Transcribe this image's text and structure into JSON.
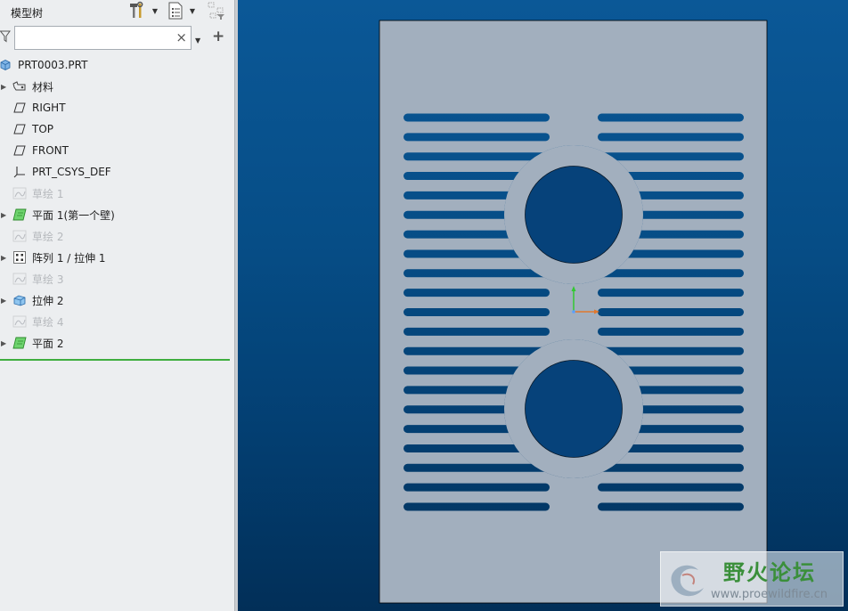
{
  "panel": {
    "title": "模型树",
    "search": {
      "value": "",
      "placeholder": "",
      "clear_symbol": "×",
      "add_symbol": "+"
    }
  },
  "tree": {
    "items": [
      {
        "label": "PRT0003.PRT",
        "icon": "part-icon",
        "expandable": false,
        "suppressed": false
      },
      {
        "label": "材料",
        "icon": "material-icon",
        "expandable": true,
        "suppressed": false
      },
      {
        "label": "RIGHT",
        "icon": "datum-plane-icon",
        "expandable": false,
        "suppressed": false
      },
      {
        "label": "TOP",
        "icon": "datum-plane-icon",
        "expandable": false,
        "suppressed": false
      },
      {
        "label": "FRONT",
        "icon": "datum-plane-icon",
        "expandable": false,
        "suppressed": false
      },
      {
        "label": "PRT_CSYS_DEF",
        "icon": "csys-icon",
        "expandable": false,
        "suppressed": false
      },
      {
        "label": "草绘 1",
        "icon": "sketch-icon",
        "expandable": false,
        "suppressed": true
      },
      {
        "label": "平面 1(第一个壁)",
        "icon": "sheetmetal-wall-icon",
        "expandable": true,
        "suppressed": false
      },
      {
        "label": "草绘 2",
        "icon": "sketch-icon",
        "expandable": false,
        "suppressed": true
      },
      {
        "label": "阵列 1 / 拉伸 1",
        "icon": "pattern-icon",
        "expandable": true,
        "suppressed": false
      },
      {
        "label": "草绘 3",
        "icon": "sketch-icon",
        "expandable": false,
        "suppressed": true
      },
      {
        "label": "拉伸 2",
        "icon": "extrude-icon",
        "expandable": true,
        "suppressed": false
      },
      {
        "label": "草绘 4",
        "icon": "sketch-icon",
        "expandable": false,
        "suppressed": true
      },
      {
        "label": "平面 2",
        "icon": "sheetmetal-wall-icon",
        "expandable": true,
        "suppressed": false
      }
    ]
  },
  "watermark": {
    "title": "野火论坛",
    "url": "www.proewildfire.cn"
  },
  "colors": {
    "viewport_top": "#0b5897",
    "viewport_bottom": "#022f58",
    "part_fill": "#a2afbe",
    "cutout_fill": "#06427a",
    "tree_end_marker": "#3fae3f"
  }
}
